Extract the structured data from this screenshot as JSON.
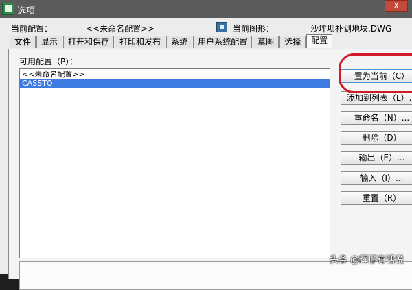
{
  "window": {
    "title": "选项",
    "close_label": "X"
  },
  "info": {
    "current_profile_label": "当前配置：",
    "current_profile_value": "<<未命名配置>>",
    "current_drawing_label": "当前图形：",
    "current_drawing_value": "沙坪坝补划地块.DWG"
  },
  "tabs": [
    {
      "label": "文件"
    },
    {
      "label": "显示"
    },
    {
      "label": "打开和保存"
    },
    {
      "label": "打印和发布"
    },
    {
      "label": "系统"
    },
    {
      "label": "用户系统配置"
    },
    {
      "label": "草图"
    },
    {
      "label": "选择"
    },
    {
      "label": "配置",
      "active": true
    }
  ],
  "panel": {
    "available_label": "可用配置（P）：",
    "profiles": [
      {
        "name": "<<未命名配置>>"
      },
      {
        "name": "CASSTO",
        "selected": true
      }
    ]
  },
  "buttons": [
    {
      "label": "置为当前（C）"
    },
    {
      "label": "添加到列表（L）..."
    },
    {
      "label": "重命名（N）..."
    },
    {
      "label": "删除（D）"
    },
    {
      "label": "输出（E）..."
    },
    {
      "label": "输入（I）..."
    },
    {
      "label": "重置（R）"
    }
  ],
  "watermark": "头条 @辉仔有话说",
  "colors": {
    "selection": "#3d7be0",
    "highlight_circle": "#d01a2a",
    "title_bar": "#5b5b5b"
  }
}
